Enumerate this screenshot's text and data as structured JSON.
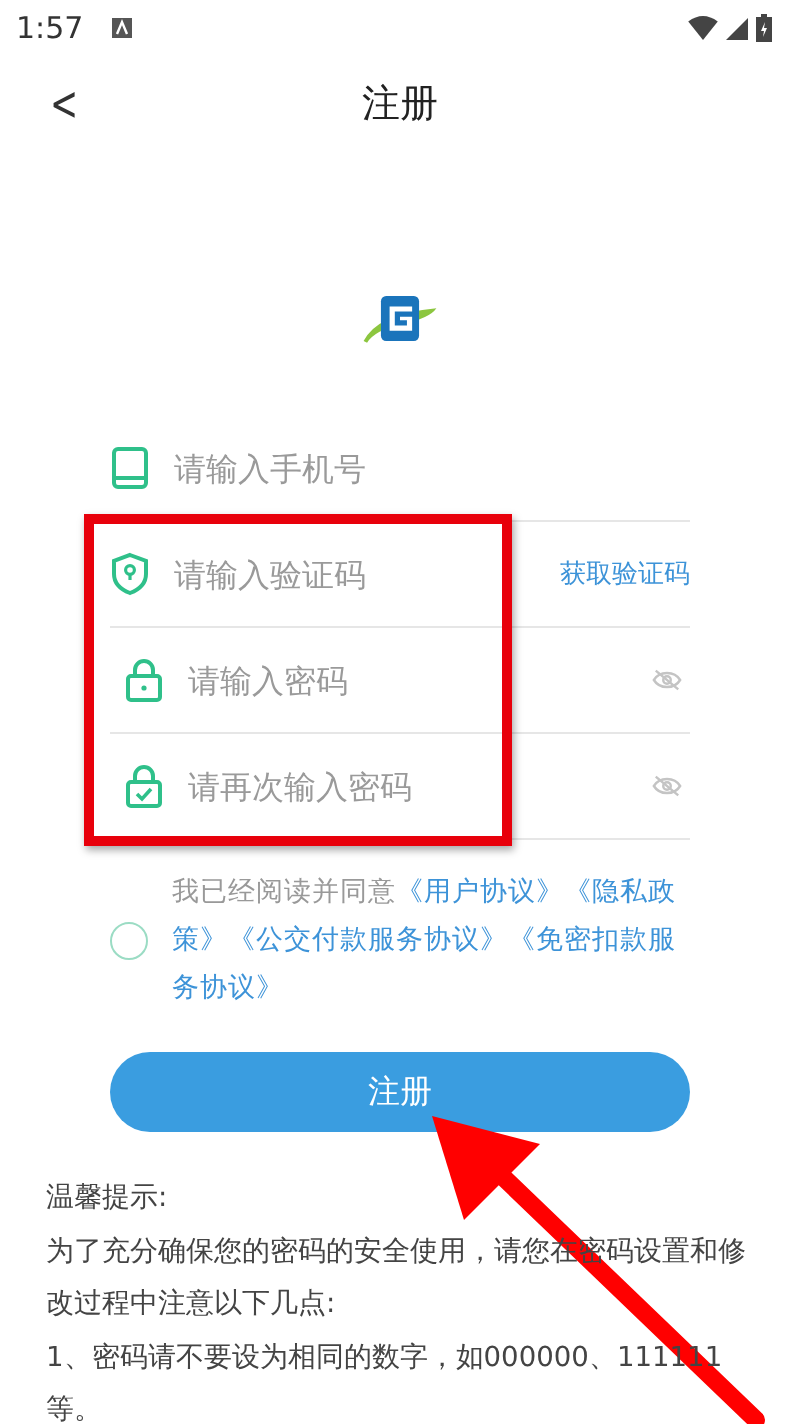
{
  "status_bar": {
    "time": "1:57"
  },
  "header": {
    "back": "<",
    "title": "注册"
  },
  "form": {
    "fields": [
      {
        "kind": "phone",
        "placeholder": "请输入手机号"
      },
      {
        "kind": "code",
        "placeholder": "请输入验证码",
        "action": "获取验证码"
      },
      {
        "kind": "password",
        "placeholder": "请输入密码"
      },
      {
        "kind": "confirm",
        "placeholder": "请再次输入密码"
      }
    ]
  },
  "agreement": {
    "checked": false,
    "prefix": "我已经阅读并同意",
    "links": [
      "《用户协议》",
      "《隐私政策》",
      "《公交付款服务协议》",
      "《免密扣款服务协议》"
    ]
  },
  "submit": "注册",
  "tips": [
    "温馨提示:",
    "为了充分确保您的密码的安全使用，请您在密码设置和修改过程中注意以下几点:",
    "1、密码请不要设为相同的数字，如000000、111111等。"
  ]
}
